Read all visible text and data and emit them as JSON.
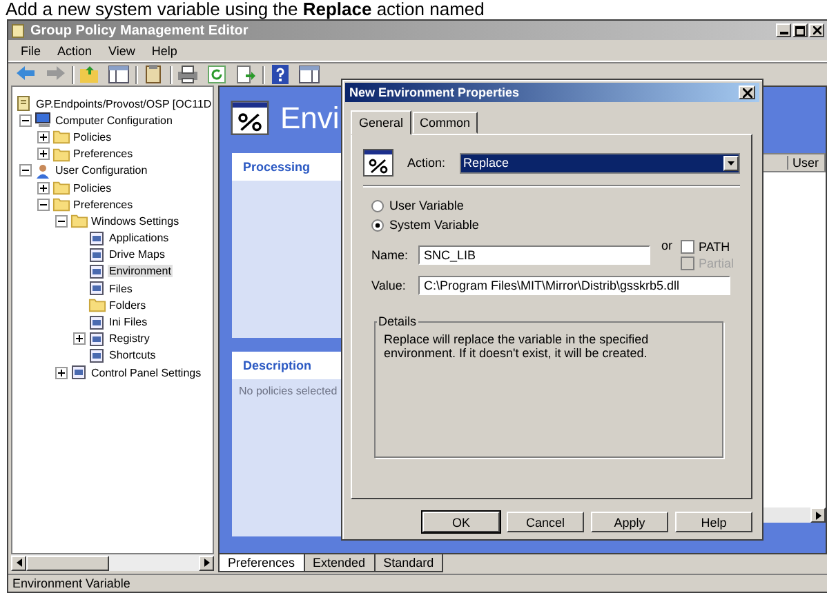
{
  "caption": "Add a new system variable using the **Replace** action named",
  "window": {
    "title": "Group Policy Management Editor"
  },
  "menu": [
    "File",
    "Action",
    "View",
    "Help"
  ],
  "tree": [
    {
      "label": "GP.Endpoints/Provost/OSP [OC11D",
      "kind": "root",
      "selected": false,
      "children": [
        {
          "label": "Computer Configuration",
          "kind": "computer",
          "selected": false,
          "expanded": true,
          "children": [
            {
              "label": "Policies",
              "kind": "folder",
              "selected": false,
              "expanded": false
            },
            {
              "label": "Preferences",
              "kind": "folder",
              "selected": false,
              "expanded": false
            }
          ]
        },
        {
          "label": "User Configuration",
          "kind": "user",
          "selected": false,
          "expanded": true,
          "children": [
            {
              "label": "Policies",
              "kind": "folder",
              "selected": false,
              "expanded": false
            },
            {
              "label": "Preferences",
              "kind": "folder",
              "selected": false,
              "expanded": true,
              "children": [
                {
                  "label": "Windows Settings",
                  "kind": "folder",
                  "selected": false,
                  "expanded": true,
                  "children": [
                    {
                      "label": "Applications",
                      "kind": "setting",
                      "selected": false
                    },
                    {
                      "label": "Drive Maps",
                      "kind": "setting",
                      "selected": false
                    },
                    {
                      "label": "Environment",
                      "kind": "setting",
                      "selected": true
                    },
                    {
                      "label": "Files",
                      "kind": "setting",
                      "selected": false
                    },
                    {
                      "label": "Folders",
                      "kind": "folder",
                      "selected": false
                    },
                    {
                      "label": "Ini Files",
                      "kind": "setting",
                      "selected": false
                    },
                    {
                      "label": "Registry",
                      "kind": "setting",
                      "selected": false,
                      "expanded": false
                    },
                    {
                      "label": "Shortcuts",
                      "kind": "setting",
                      "selected": false
                    }
                  ]
                },
                {
                  "label": "Control Panel Settings",
                  "kind": "setting",
                  "selected": false,
                  "expanded": false
                }
              ]
            }
          ]
        }
      ]
    }
  ],
  "content": {
    "heading": "Envi",
    "panels": [
      {
        "title": "Processing"
      },
      {
        "title": "Description",
        "text": "No policies selected"
      }
    ],
    "list": {
      "columns": [
        "User"
      ]
    }
  },
  "view_tabs": [
    {
      "label": "Preferences",
      "selected": true
    },
    {
      "label": "Extended",
      "selected": false
    },
    {
      "label": "Standard",
      "selected": false
    }
  ],
  "status_bar": "Environment Variable",
  "dialog": {
    "title": "New Environment Properties",
    "tabs": [
      {
        "label": "General",
        "selected": true
      },
      {
        "label": "Common",
        "selected": false
      }
    ],
    "action_label": "Action:",
    "action": "Replace",
    "variable_type": [
      {
        "label": "User Variable",
        "selected": false
      },
      {
        "label": "System Variable",
        "selected": true
      }
    ],
    "name_label": "Name:",
    "name": "SNC_LIB",
    "or_label": "or",
    "checkboxes": [
      {
        "label": "PATH",
        "checked": false,
        "disabled": false
      },
      {
        "label": "Partial",
        "checked": false,
        "disabled": true
      }
    ],
    "value_label": "Value:",
    "value": "C:\\Program Files\\MIT\\Mirror\\Distrib\\gsskrb5.dll",
    "details_title": "Details",
    "details": "Replace will replace the variable in the specified environment. If it doesn't exist, it will be created.",
    "buttons": [
      {
        "label": "OK",
        "default": true
      },
      {
        "label": "Cancel",
        "default": false
      },
      {
        "label": "Apply",
        "default": false
      },
      {
        "label": "Help",
        "default": false
      }
    ]
  }
}
